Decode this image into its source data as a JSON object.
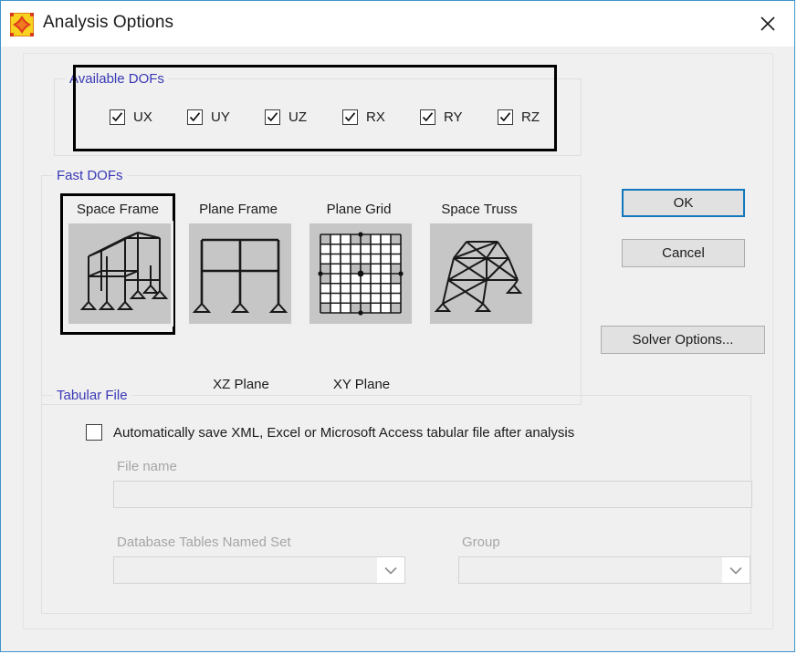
{
  "window": {
    "title": "Analysis Options",
    "app_icon": "sap2000-star-icon",
    "close_icon": "close-icon",
    "border_color": "#3f93ce"
  },
  "available_dofs": {
    "legend": "Available DOFs",
    "legend_color": "#3a39b5",
    "highlighted": true,
    "items": [
      {
        "label": "UX",
        "checked": true
      },
      {
        "label": "UY",
        "checked": true
      },
      {
        "label": "UZ",
        "checked": true
      },
      {
        "label": "RX",
        "checked": true
      },
      {
        "label": "RY",
        "checked": true
      },
      {
        "label": "RZ",
        "checked": true
      }
    ]
  },
  "fast_dofs": {
    "legend": "Fast DOFs",
    "legend_color": "#3a39b5",
    "selected": "Space Frame",
    "tiles": [
      {
        "label": "Space Frame",
        "icon": "space-frame-icon",
        "caption": "",
        "selected": true
      },
      {
        "label": "Plane Frame",
        "icon": "plane-frame-icon",
        "caption": "XZ Plane",
        "selected": false
      },
      {
        "label": "Plane Grid",
        "icon": "plane-grid-icon",
        "caption": "XY Plane",
        "selected": false
      },
      {
        "label": "Space Truss",
        "icon": "space-truss-icon",
        "caption": "",
        "selected": false
      }
    ]
  },
  "buttons": {
    "ok": "OK",
    "cancel": "Cancel",
    "solver_options": "Solver Options...",
    "focus_color": "#1277bc"
  },
  "tabular_file": {
    "legend": "Tabular File",
    "legend_color": "#3a39b5",
    "auto_save": {
      "label": "Automatically save XML, Excel or Microsoft Access tabular file after analysis",
      "checked": false
    },
    "file_name": {
      "label": "File name",
      "value": "",
      "disabled": true
    },
    "database_tables_named_set": {
      "label": "Database Tables Named Set",
      "value": "",
      "disabled": true,
      "arrow_icon": "chevron-down-icon"
    },
    "group": {
      "label": "Group",
      "value": "",
      "disabled": true,
      "arrow_icon": "chevron-down-icon"
    }
  }
}
